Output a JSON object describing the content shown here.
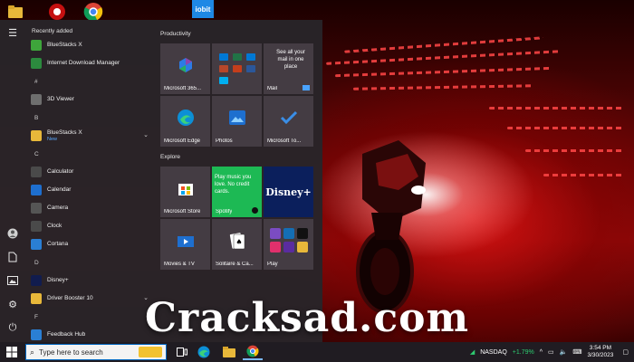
{
  "watermark": "Cracksad.com",
  "desktop": {
    "icons": [
      {
        "name": "folder-icon"
      },
      {
        "name": "antivirus-icon"
      },
      {
        "name": "chrome-icon"
      },
      {
        "name": "iobit-icon",
        "label": "iobit"
      }
    ]
  },
  "start_menu": {
    "recently_added_label": "Recently added",
    "app_list": [
      {
        "type": "app",
        "label": "BlueStacks X",
        "icon": "bluestacks-icon",
        "color": "#3ea53b"
      },
      {
        "type": "app",
        "label": "Internet Download Manager",
        "icon": "idm-icon",
        "color": "#2c8a3e"
      },
      {
        "type": "letter",
        "label": "#"
      },
      {
        "type": "app",
        "label": "3D Viewer",
        "icon": "cube-icon",
        "color": "#6e6e6e"
      },
      {
        "type": "letter",
        "label": "B"
      },
      {
        "type": "app",
        "label": "BlueStacks X",
        "sub": "New",
        "icon": "folder-icon",
        "color": "#e8b83a",
        "expandable": true
      },
      {
        "type": "letter",
        "label": "C"
      },
      {
        "type": "app",
        "label": "Calculator",
        "icon": "calculator-icon",
        "color": "#4a4a4a"
      },
      {
        "type": "app",
        "label": "Calendar",
        "icon": "calendar-icon",
        "color": "#1e6fcf"
      },
      {
        "type": "app",
        "label": "Camera",
        "icon": "camera-icon",
        "color": "#555"
      },
      {
        "type": "app",
        "label": "Clock",
        "icon": "clock-icon",
        "color": "#4a4a4a"
      },
      {
        "type": "app",
        "label": "Cortana",
        "icon": "cortana-icon",
        "color": "#2a7fd4"
      },
      {
        "type": "letter",
        "label": "D"
      },
      {
        "type": "app",
        "label": "Disney+",
        "icon": "disney-icon",
        "color": "#111c4e"
      },
      {
        "type": "app",
        "label": "Driver Booster 10",
        "icon": "folder-icon",
        "color": "#e8b83a",
        "expandable": true
      },
      {
        "type": "letter",
        "label": "F"
      },
      {
        "type": "app",
        "label": "Feedback Hub",
        "icon": "feedback-icon",
        "color": "#2a7fd4"
      }
    ],
    "groups": [
      {
        "title": "Productivity",
        "tiles": [
          {
            "label": "Microsoft 365...",
            "icon": "office-icon"
          },
          {
            "label": "",
            "icon": "office-apps-icon"
          },
          {
            "label": "Mail",
            "text": "See all your mail in one place",
            "icon": "mail-icon"
          },
          {
            "label": "Microsoft Edge",
            "icon": "edge-icon"
          },
          {
            "label": "Photos",
            "icon": "photos-icon"
          },
          {
            "label": "Microsoft To...",
            "icon": "todo-icon"
          }
        ]
      },
      {
        "title": "Explore",
        "tiles": [
          {
            "label": "Microsoft Store",
            "icon": "store-icon"
          },
          {
            "label": "Spotify",
            "text": "Play music you love. No credit cards.",
            "icon": "spotify-icon",
            "bg": "#1db954"
          },
          {
            "label": "",
            "text": "Disney+",
            "icon": "disney-icon",
            "bg": "#0b1f5c"
          },
          {
            "label": "Movies & TV",
            "icon": "movies-icon"
          },
          {
            "label": "Solitaire & Ca...",
            "icon": "solitaire-icon"
          },
          {
            "label": "Play",
            "icon": "play-folder-icon"
          }
        ]
      }
    ]
  },
  "taskbar": {
    "search_placeholder": "Type here to search",
    "ticker_name": "NASDAQ",
    "ticker_change": "+1.79%",
    "time": "3:54 PM",
    "date": "3/30/2023"
  }
}
